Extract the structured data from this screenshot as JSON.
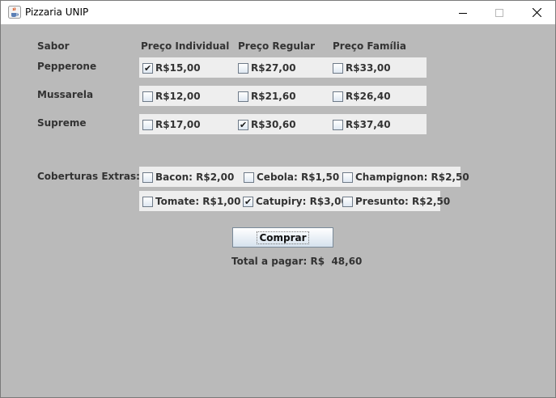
{
  "window": {
    "title": "Pizzaria UNIP",
    "icon": "java-cup-icon",
    "controls": [
      "minimize-icon",
      "maximize-icon",
      "close-icon"
    ]
  },
  "headers": {
    "sabor": "Sabor",
    "individual": "Preço Individual",
    "regular": "Preço Regular",
    "familia": "Preço Família"
  },
  "pizzas": [
    {
      "name": "Pepperone",
      "prices": [
        {
          "label": "R$15,00",
          "checked": true
        },
        {
          "label": "R$27,00",
          "checked": false
        },
        {
          "label": "R$33,00",
          "checked": false
        }
      ]
    },
    {
      "name": "Mussarela",
      "prices": [
        {
          "label": "R$12,00",
          "checked": false
        },
        {
          "label": "R$21,60",
          "checked": false
        },
        {
          "label": "R$26,40",
          "checked": false
        }
      ]
    },
    {
      "name": "Supreme",
      "prices": [
        {
          "label": "R$17,00",
          "checked": false
        },
        {
          "label": "R$30,60",
          "checked": true
        },
        {
          "label": "R$37,40",
          "checked": false
        }
      ]
    }
  ],
  "extras": {
    "label": "Coberturas Extras:",
    "items": [
      {
        "label": "Bacon: R$2,00",
        "checked": false
      },
      {
        "label": "Cebola: R$1,50",
        "checked": false
      },
      {
        "label": "Champignon: R$2,50",
        "checked": false
      },
      {
        "label": "Tomate: R$1,00",
        "checked": false
      },
      {
        "label": "Catupiry: R$3,00",
        "checked": true
      },
      {
        "label": "Presunto: R$2,50",
        "checked": false
      }
    ]
  },
  "buy_button": "Comprar",
  "total_text": "Total a pagar: R$  48,60",
  "check_glyph": "✔"
}
